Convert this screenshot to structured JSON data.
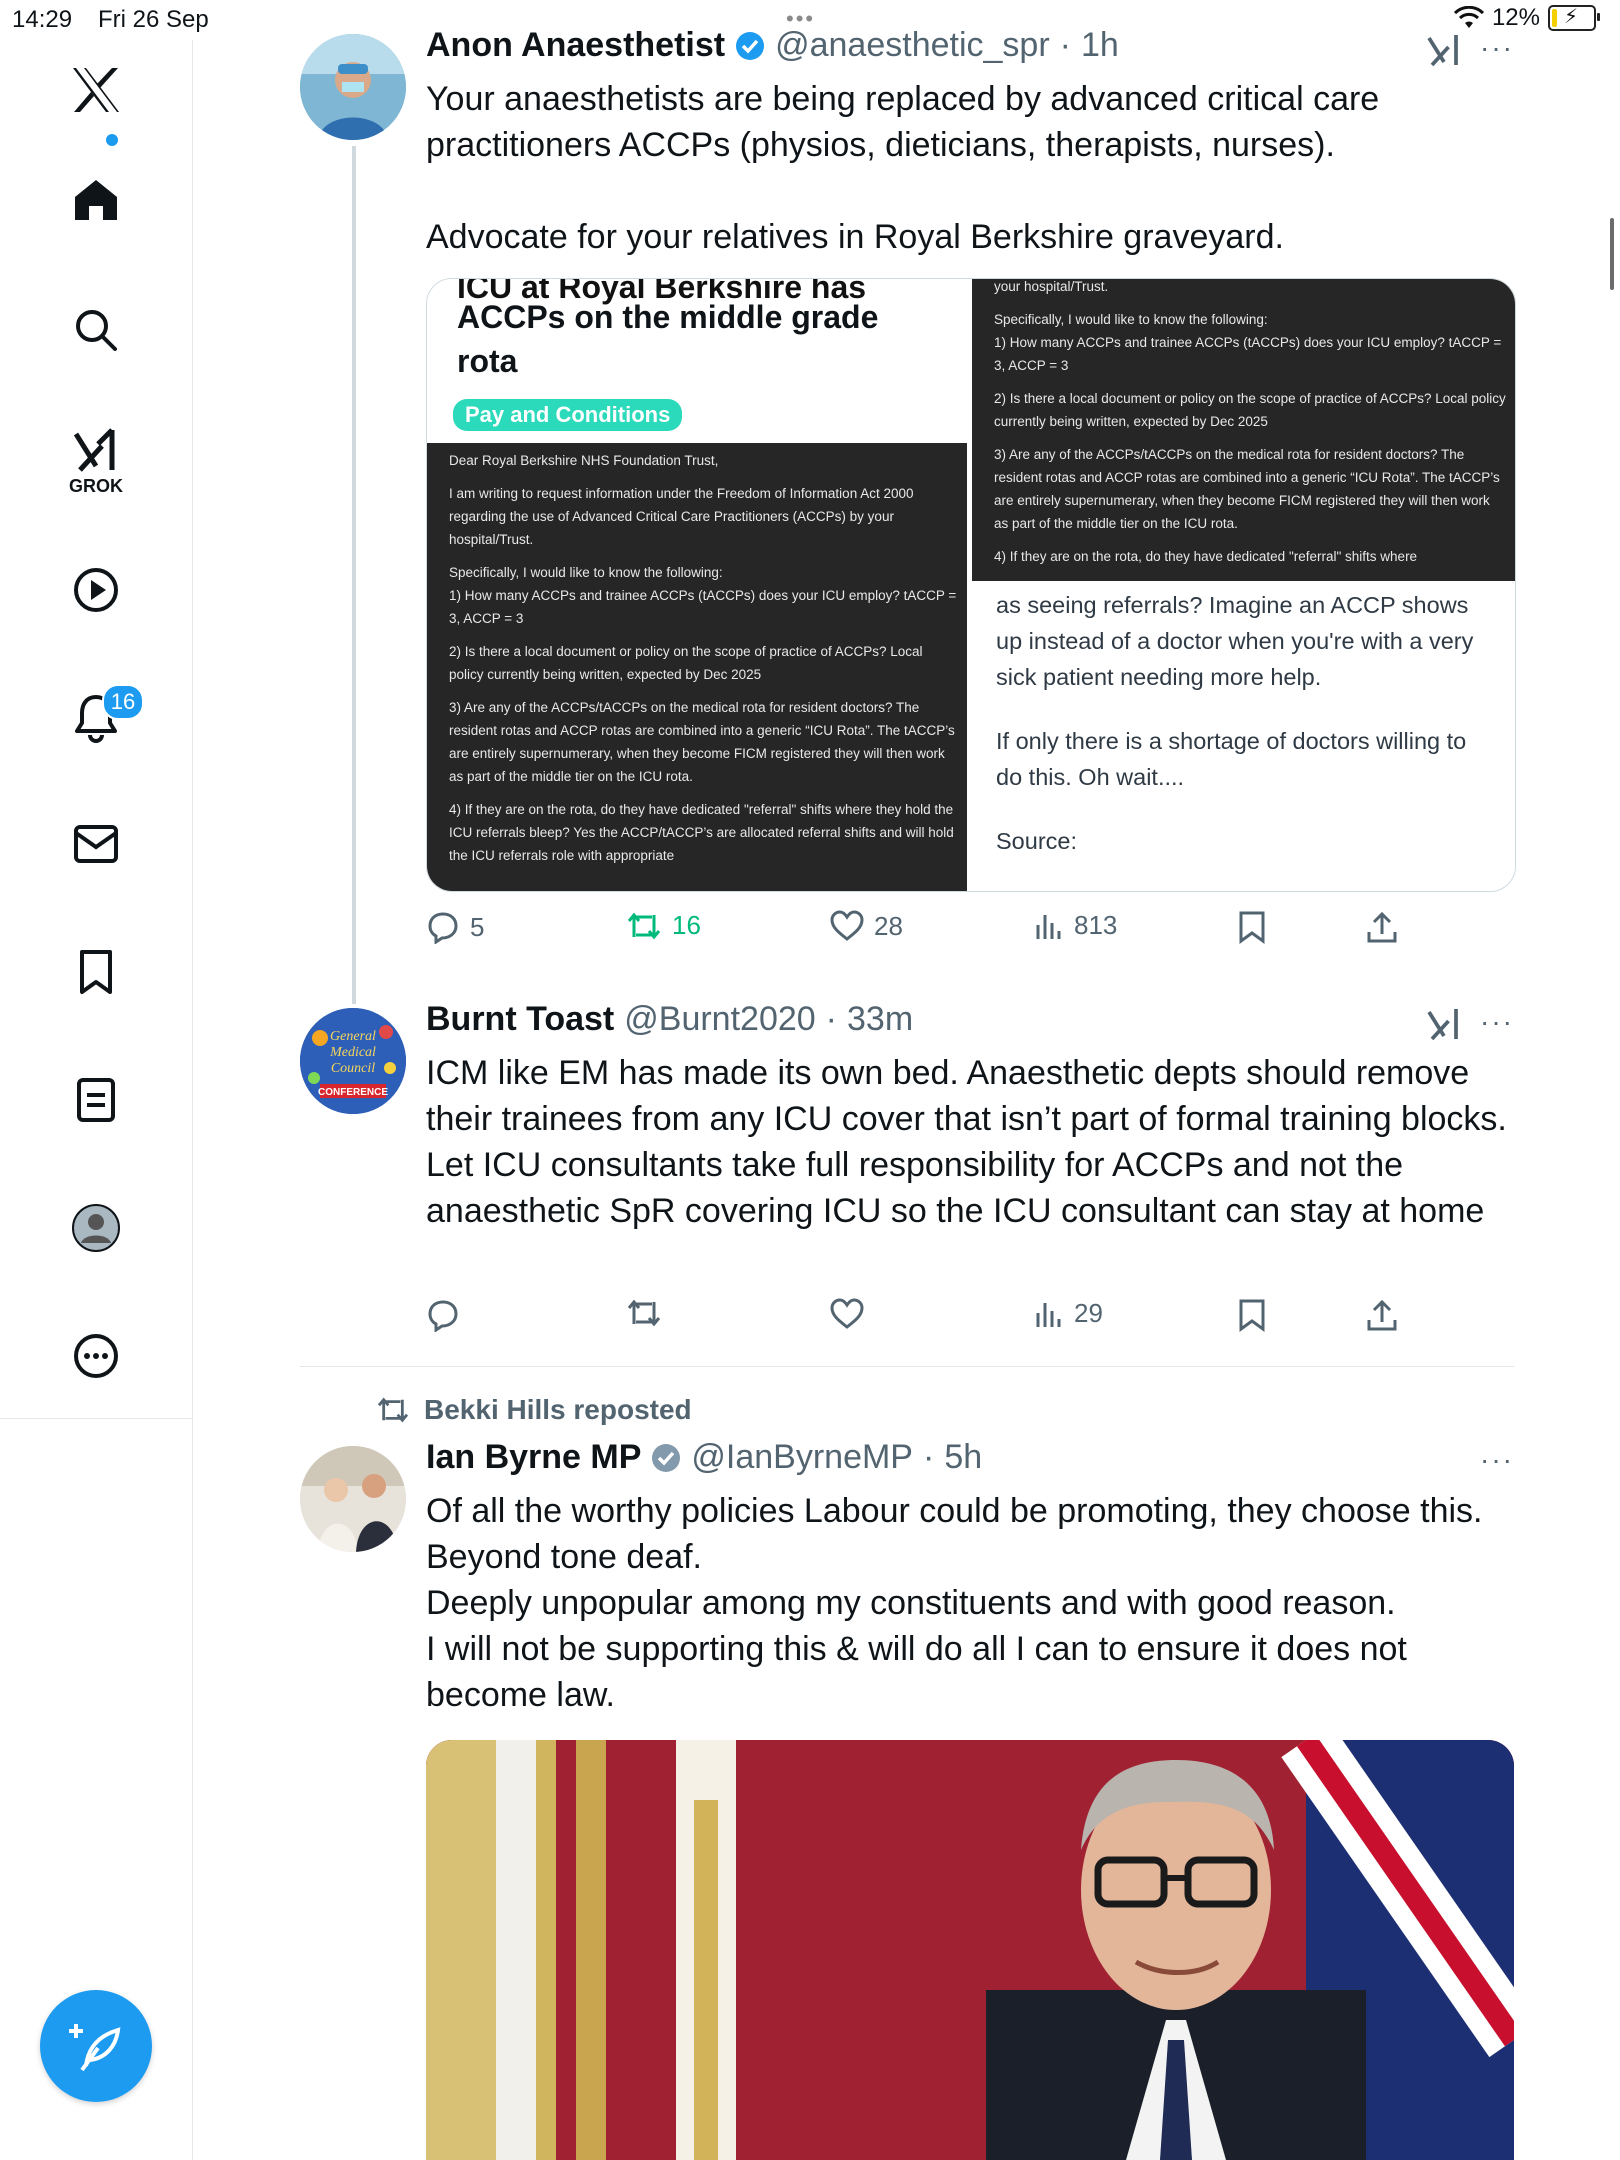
{
  "status_bar": {
    "time": "14:29",
    "date": "Fri 26 Sep",
    "battery": "12%",
    "battery_level": 0.12
  },
  "sidebar": {
    "grok_label": "GROK",
    "notifications_badge": "16"
  },
  "tweets": [
    {
      "name": "Anon Anaesthetist",
      "handle": "@anaesthetic_spr",
      "time": "1h",
      "text": "Your anaesthetists are being replaced by advanced critical care practitioners ACCPs (physios, dieticians, therapists, nurses).\n\nAdvocate for your relatives in Royal Berkshire graveyard.",
      "media": {
        "left_title_cut": "ICU at Royal Berkshire has",
        "left_title": "ACCPs on the middle grade rota",
        "tag": "Pay and Conditions",
        "doc_left": [
          "Dear Royal Berkshire NHS Foundation Trust,",
          "I am writing to request information under the Freedom of Information Act 2000 regarding the use of Advanced Critical Care Practitioners (ACCPs) by your hospital/Trust.",
          "Specifically, I would like to know the following:\n1) How many ACCPs and trainee ACCPs (tACCPs) does your ICU employ? tACCP = 3, ACCP = 3",
          "2) Is there a local document or policy on the scope of practice of ACCPs? Local policy currently being written, expected by Dec 2025",
          "3) Are any of the ACCPs/tACCPs on the medical rota for resident doctors? The resident rotas and ACCP rotas are combined into a generic “ICU Rota”. The tACCP’s are entirely supernumerary, when they become FICM registered they will then work as part of the middle tier on the ICU rota.",
          "4) If they are on the rota, do they have dedicated \"referral\" shifts where they hold the ICU referrals bleep? Yes the ACCP/tACCP’s are allocated referral shifts and will hold the ICU referrals role with appropriate"
        ],
        "doc_right": [
          "your hospital/Trust.",
          "Specifically, I would like to know the following:\n1) How many ACCPs and trainee ACCPs (tACCPs) does your ICU employ? tACCP = 3, ACCP = 3",
          "2) Is there a local document or policy on the scope of practice of ACCPs? Local policy currently being written, expected by Dec 2025",
          "3) Are any of the ACCPs/tACCPs on the medical rota for resident doctors? The resident rotas and ACCP rotas are combined into a generic “ICU Rota”. The tACCP’s are entirely supernumerary, when they become FICM registered they will then work as part of the middle tier on the ICU rota.",
          "4) If they are on the rota, do they have dedicated \"referral\" shifts where"
        ],
        "right_body_1": "as seeing referrals? Imagine an ACCP shows up instead of a doctor when you're with a very sick patient needing more help.",
        "right_body_2": "If only there is a shortage of doctors willing to do this. Oh wait....",
        "right_body_3": "Source:"
      },
      "replies": "5",
      "reposts": "16",
      "likes": "28",
      "views": "813"
    },
    {
      "name": "Burnt Toast",
      "handle": "@Burnt2020",
      "time": "33m",
      "text": "ICM like EM has made its own bed. Anaesthetic depts should remove their trainees from any ICU cover that isn’t part of formal training blocks. Let ICU consultants take full responsibility for ACCPs and not the anaesthetic SpR covering ICU so the ICU consultant can stay at home",
      "avatar_text": [
        "General",
        "Medical",
        "Council",
        "CONFERENCE"
      ],
      "replies": "",
      "reposts": "",
      "likes": "",
      "views": "29"
    },
    {
      "reposted_by": "Bekki Hills reposted",
      "name": "Ian Byrne MP",
      "handle": "@IanByrneMP",
      "time": "5h",
      "text": "Of all the worthy policies Labour could be promoting, they choose this.\nBeyond tone deaf.\nDeeply unpopular among my constituents and with good reason.\nI will not be supporting this & will do all I can to ensure it does not become law."
    }
  ],
  "colors": {
    "accent": "#1d9bf0",
    "repost_green": "#00ba7c",
    "muted": "#536471",
    "tag": "#2bd9bb"
  }
}
